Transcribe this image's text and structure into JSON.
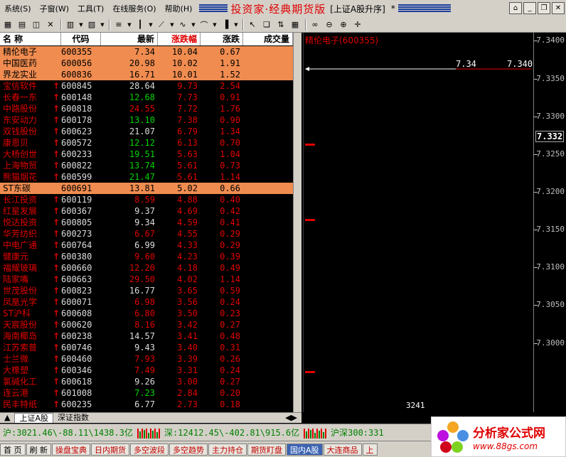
{
  "menu": {
    "items": [
      "系统(S)",
      "子窗(W)",
      "工具(T)",
      "在线服务(O)",
      "帮助(H)"
    ],
    "title_main": "投资家·经典期货版",
    "title_sub": "[上证A股升序]",
    "title_star": "*"
  },
  "window_controls": [
    "home-icon",
    "minimize-icon",
    "restore-icon",
    "close-icon"
  ],
  "toolbar_icons": [
    "grid-icon",
    "layout-icon",
    "split-icon",
    "close-icon",
    "table-icon",
    "chart-icon",
    "list-icon",
    "kline-icon",
    "line-draw-icon",
    "wave-icon",
    "curve-icon",
    "bar-icon",
    "cursor-icon",
    "pages-icon",
    "arrows-icon",
    "grid2-icon",
    "link-icon",
    "zoomout-icon",
    "zoomin-icon",
    "crosshair-icon"
  ],
  "table": {
    "headers": {
      "name": "名 称",
      "code": "代码",
      "price": "最新",
      "pct": "涨跌幅",
      "chg": "涨跌",
      "vol": "成交量"
    },
    "rows": [
      {
        "name": "精伦电子",
        "arrow": "",
        "code": "600355",
        "price": "7.34",
        "price_color": "red",
        "pct": "10.04",
        "chg": "0.67",
        "hl": true
      },
      {
        "name": "中国医药",
        "arrow": "",
        "code": "600056",
        "price": "20.98",
        "price_color": "red",
        "pct": "10.02",
        "chg": "1.91",
        "hl": true
      },
      {
        "name": "界龙实业",
        "arrow": "",
        "code": "600836",
        "price": "16.71",
        "price_color": "red",
        "pct": "10.01",
        "chg": "1.52",
        "hl": true
      },
      {
        "name": "宝信软件",
        "arrow": "↑",
        "code": "600845",
        "price": "28.64",
        "price_color": "white",
        "pct": "9.73",
        "chg": "2.54",
        "hl": false
      },
      {
        "name": "长春一东",
        "arrow": "↑",
        "code": "600148",
        "price": "12.68",
        "price_color": "green",
        "pct": "7.73",
        "chg": "0.91",
        "hl": false
      },
      {
        "name": "中路股份",
        "arrow": "↑",
        "code": "600818",
        "price": "24.55",
        "price_color": "red",
        "pct": "7.72",
        "chg": "1.76",
        "hl": false
      },
      {
        "name": "东安动力",
        "arrow": "↑",
        "code": "600178",
        "price": "13.10",
        "price_color": "green",
        "pct": "7.38",
        "chg": "0.90",
        "hl": false
      },
      {
        "name": "双钱股份",
        "arrow": "↑",
        "code": "600623",
        "price": "21.07",
        "price_color": "white",
        "pct": "6.79",
        "chg": "1.34",
        "hl": false
      },
      {
        "name": "康恩贝",
        "arrow": "↑",
        "code": "600572",
        "price": "12.12",
        "price_color": "green",
        "pct": "6.13",
        "chg": "0.70",
        "hl": false
      },
      {
        "name": "大杨创世",
        "arrow": "↑",
        "code": "600233",
        "price": "19.51",
        "price_color": "green",
        "pct": "5.63",
        "chg": "1.04",
        "hl": false
      },
      {
        "name": "上海物贸",
        "arrow": "↑",
        "code": "600822",
        "price": "13.74",
        "price_color": "green",
        "pct": "5.61",
        "chg": "0.73",
        "hl": false
      },
      {
        "name": "熊猫烟花",
        "arrow": "↑",
        "code": "600599",
        "price": "21.47",
        "price_color": "green",
        "pct": "5.61",
        "chg": "1.14",
        "hl": false
      },
      {
        "name": "ST东碳",
        "arrow": "",
        "code": "600691",
        "price": "13.81",
        "price_color": "red",
        "pct": "5.02",
        "chg": "0.66",
        "hl": true
      },
      {
        "name": "长江投资",
        "arrow": "↑",
        "code": "600119",
        "price": "8.59",
        "price_color": "red",
        "pct": "4.88",
        "chg": "0.40",
        "hl": false
      },
      {
        "name": "红星发展",
        "arrow": "↑",
        "code": "600367",
        "price": "9.37",
        "price_color": "white",
        "pct": "4.69",
        "chg": "0.42",
        "hl": false
      },
      {
        "name": "悦达投资",
        "arrow": "↑",
        "code": "600805",
        "price": "9.34",
        "price_color": "white",
        "pct": "4.59",
        "chg": "0.41",
        "hl": false
      },
      {
        "name": "华芳纺织",
        "arrow": "↑",
        "code": "600273",
        "price": "6.67",
        "price_color": "red",
        "pct": "4.55",
        "chg": "0.29",
        "hl": false
      },
      {
        "name": "中电广通",
        "arrow": "↑",
        "code": "600764",
        "price": "6.99",
        "price_color": "white",
        "pct": "4.33",
        "chg": "0.29",
        "hl": false
      },
      {
        "name": "健康元",
        "arrow": "↑",
        "code": "600380",
        "price": "9.60",
        "price_color": "red",
        "pct": "4.23",
        "chg": "0.39",
        "hl": false
      },
      {
        "name": "福耀玻璃",
        "arrow": "↑",
        "code": "600660",
        "price": "12.20",
        "price_color": "red",
        "pct": "4.18",
        "chg": "0.49",
        "hl": false
      },
      {
        "name": "陆家嘴",
        "arrow": "↑",
        "code": "600663",
        "price": "29.50",
        "price_color": "red",
        "pct": "4.02",
        "chg": "1.14",
        "hl": false
      },
      {
        "name": "世茂股份",
        "arrow": "↑",
        "code": "600823",
        "price": "16.77",
        "price_color": "white",
        "pct": "3.65",
        "chg": "0.59",
        "hl": false
      },
      {
        "name": "凤凰光学",
        "arrow": "↑",
        "code": "600071",
        "price": "6.98",
        "price_color": "red",
        "pct": "3.56",
        "chg": "0.24",
        "hl": false
      },
      {
        "name": "ST沪科",
        "arrow": "↑",
        "code": "600608",
        "price": "6.80",
        "price_color": "red",
        "pct": "3.50",
        "chg": "0.23",
        "hl": false
      },
      {
        "name": "天宸股份",
        "arrow": "↑",
        "code": "600620",
        "price": "8.16",
        "price_color": "red",
        "pct": "3.42",
        "chg": "0.27",
        "hl": false
      },
      {
        "name": "海南椰岛",
        "arrow": "↑",
        "code": "600238",
        "price": "14.57",
        "price_color": "white",
        "pct": "3.41",
        "chg": "0.48",
        "hl": false
      },
      {
        "name": "江苏索普",
        "arrow": "↑",
        "code": "600746",
        "price": "9.43",
        "price_color": "white",
        "pct": "3.40",
        "chg": "0.31",
        "hl": false
      },
      {
        "name": "士兰微",
        "arrow": "↑",
        "code": "600460",
        "price": "7.93",
        "price_color": "red",
        "pct": "3.39",
        "chg": "0.26",
        "hl": false
      },
      {
        "name": "大橡塑",
        "arrow": "↑",
        "code": "600346",
        "price": "7.49",
        "price_color": "red",
        "pct": "3.31",
        "chg": "0.24",
        "hl": false
      },
      {
        "name": "氯碱化工",
        "arrow": "↑",
        "code": "600618",
        "price": "9.26",
        "price_color": "white",
        "pct": "3.00",
        "chg": "0.27",
        "hl": false
      },
      {
        "name": "连云港",
        "arrow": "↑",
        "code": "601008",
        "price": "7.23",
        "price_color": "green",
        "pct": "2.84",
        "chg": "0.20",
        "hl": false
      },
      {
        "name": "民丰特纸",
        "arrow": "↑",
        "code": "600235",
        "price": "6.77",
        "price_color": "white",
        "pct": "2.73",
        "chg": "0.18",
        "hl": false
      }
    ]
  },
  "chart": {
    "title": "精伦电子(600355)",
    "line_value": "7.34",
    "line_value_right": "7.340",
    "current_price": "7.332",
    "axis_ticks": [
      "7.3400",
      "7.3350",
      "7.3300",
      "7.3250",
      "7.3200",
      "7.3150",
      "7.3100",
      "7.3050",
      "7.3000"
    ],
    "bottom_value": "3241"
  },
  "tabs": [
    "上证A股",
    "深证指数"
  ],
  "status1": {
    "sh": "沪:3021.46\\-88.11\\1438.3亿",
    "sz": "深:12412.45\\-402.81\\915.6亿",
    "hs300": "沪深300:331"
  },
  "status2": {
    "buttons": [
      "首 页",
      "刷 新",
      "操盘宝典",
      "日内期货",
      "多空波段",
      "多空趋势",
      "主力持仓",
      "期货盯盘",
      "国内A股",
      "大连商品",
      "上"
    ]
  },
  "brand": {
    "title": "分析家公式网",
    "url": "www.88gs.com"
  },
  "colors": {
    "up": "#e00000",
    "down": "#00d400",
    "flat": "#dcdcdc",
    "highlight": "#f08c50"
  }
}
